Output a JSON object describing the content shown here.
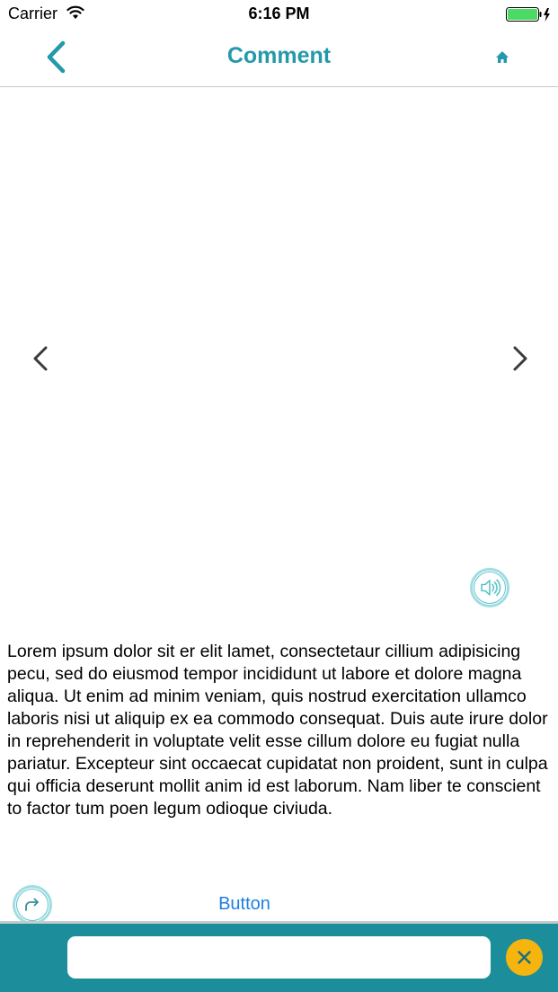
{
  "status_bar": {
    "carrier": "Carrier",
    "time": "6:16 PM"
  },
  "nav": {
    "title": "Comment",
    "back_icon": "chevron-left-icon",
    "home_icon": "home-icon"
  },
  "media": {
    "prev_icon": "chevron-left-icon",
    "next_icon": "chevron-right-icon",
    "audio_icon": "speaker-icon"
  },
  "body": {
    "text": "Lorem ipsum dolor sit er elit lamet, consectetaur cillium adipisicing pecu, sed do eiusmod tempor incididunt ut labore et dolore magna aliqua. Ut enim ad minim veniam, quis nostrud exercitation ullamco laboris nisi ut aliquip ex ea commodo consequat. Duis aute irure dolor in reprehenderit in voluptate velit esse cillum dolore eu fugiat nulla pariatur. Excepteur sint occaecat cupidatat non proident, sunt in culpa qui officia deserunt mollit anim id est laborum. Nam liber te conscient to factor tum poen legum odioque civiuda."
  },
  "actions": {
    "share_icon": "share-icon",
    "button_label": "Button"
  },
  "input_bar": {
    "value": "",
    "placeholder": "",
    "close_icon": "close-icon"
  },
  "colors": {
    "accent": "#2499a9",
    "input_bar_bg": "#1c8e9b",
    "close_button": "#f6b40f",
    "link_blue": "#1d7fe0",
    "battery_green": "#4cd964"
  }
}
